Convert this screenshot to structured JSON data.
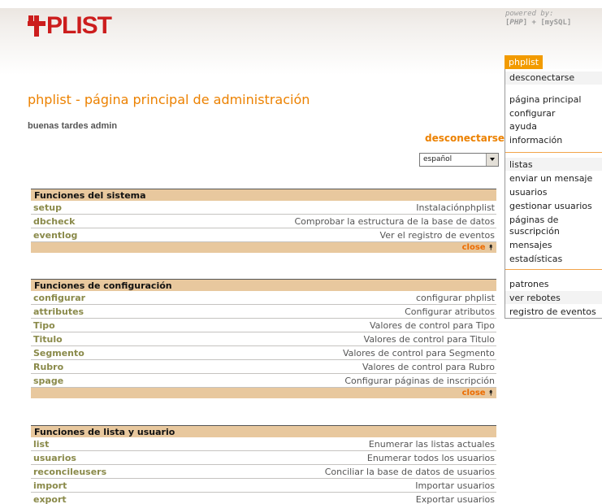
{
  "header": {
    "logo_text": "PLIST",
    "powered_line1": "powered by:",
    "powered_php": "PHP",
    "powered_plus": " + ",
    "powered_mysql": "mySQL"
  },
  "menu": {
    "tab_label": "phplist",
    "items": [
      "desconectarse",
      "página principal",
      "configurar",
      "ayuda",
      "información",
      "listas",
      "enviar un mensaje",
      "usuarios",
      "gestionar usuarios",
      "páginas de",
      "suscripción",
      "mensajes",
      "estadísticas",
      "patrones",
      "ver rebotes",
      "registro de eventos"
    ]
  },
  "main": {
    "title": "phplist - página principal de administración",
    "greeting": "buenas tardes admin",
    "logout": "desconectarse",
    "language": "español"
  },
  "sections": [
    {
      "title": "Funciones del sistema",
      "close": "close",
      "rows": [
        {
          "key": "setup",
          "desc": "Instalaciónphplist"
        },
        {
          "key": "dbcheck",
          "desc": "Comprobar la estructura de la base de datos"
        },
        {
          "key": "eventlog",
          "desc": "Ver el registro de eventos"
        }
      ]
    },
    {
      "title": "Funciones de configuración",
      "close": "close",
      "rows": [
        {
          "key": "configurar",
          "desc": "configurar phplist"
        },
        {
          "key": "attributes",
          "desc": "Configurar atributos"
        },
        {
          "key": "Tipo",
          "desc": "Valores de control para Tipo"
        },
        {
          "key": "Titulo",
          "desc": "Valores de control para Titulo"
        },
        {
          "key": "Segmento",
          "desc": "Valores de control para Segmento"
        },
        {
          "key": "Rubro",
          "desc": "Valores de control para Rubro"
        },
        {
          "key": "spage",
          "desc": "Configurar páginas de inscripción"
        }
      ]
    },
    {
      "title": "Funciones de lista y usuario",
      "rows": [
        {
          "key": "list",
          "desc": "Enumerar las listas actuales"
        },
        {
          "key": "usuarios",
          "desc": "Enumerar todos los usuarios"
        },
        {
          "key": "reconcileusers",
          "desc": "Conciliar la base de datos de usuarios"
        },
        {
          "key": "import",
          "desc": "Importar usuarios"
        },
        {
          "key": "export",
          "desc": "Exportar usuarios"
        }
      ]
    }
  ]
}
